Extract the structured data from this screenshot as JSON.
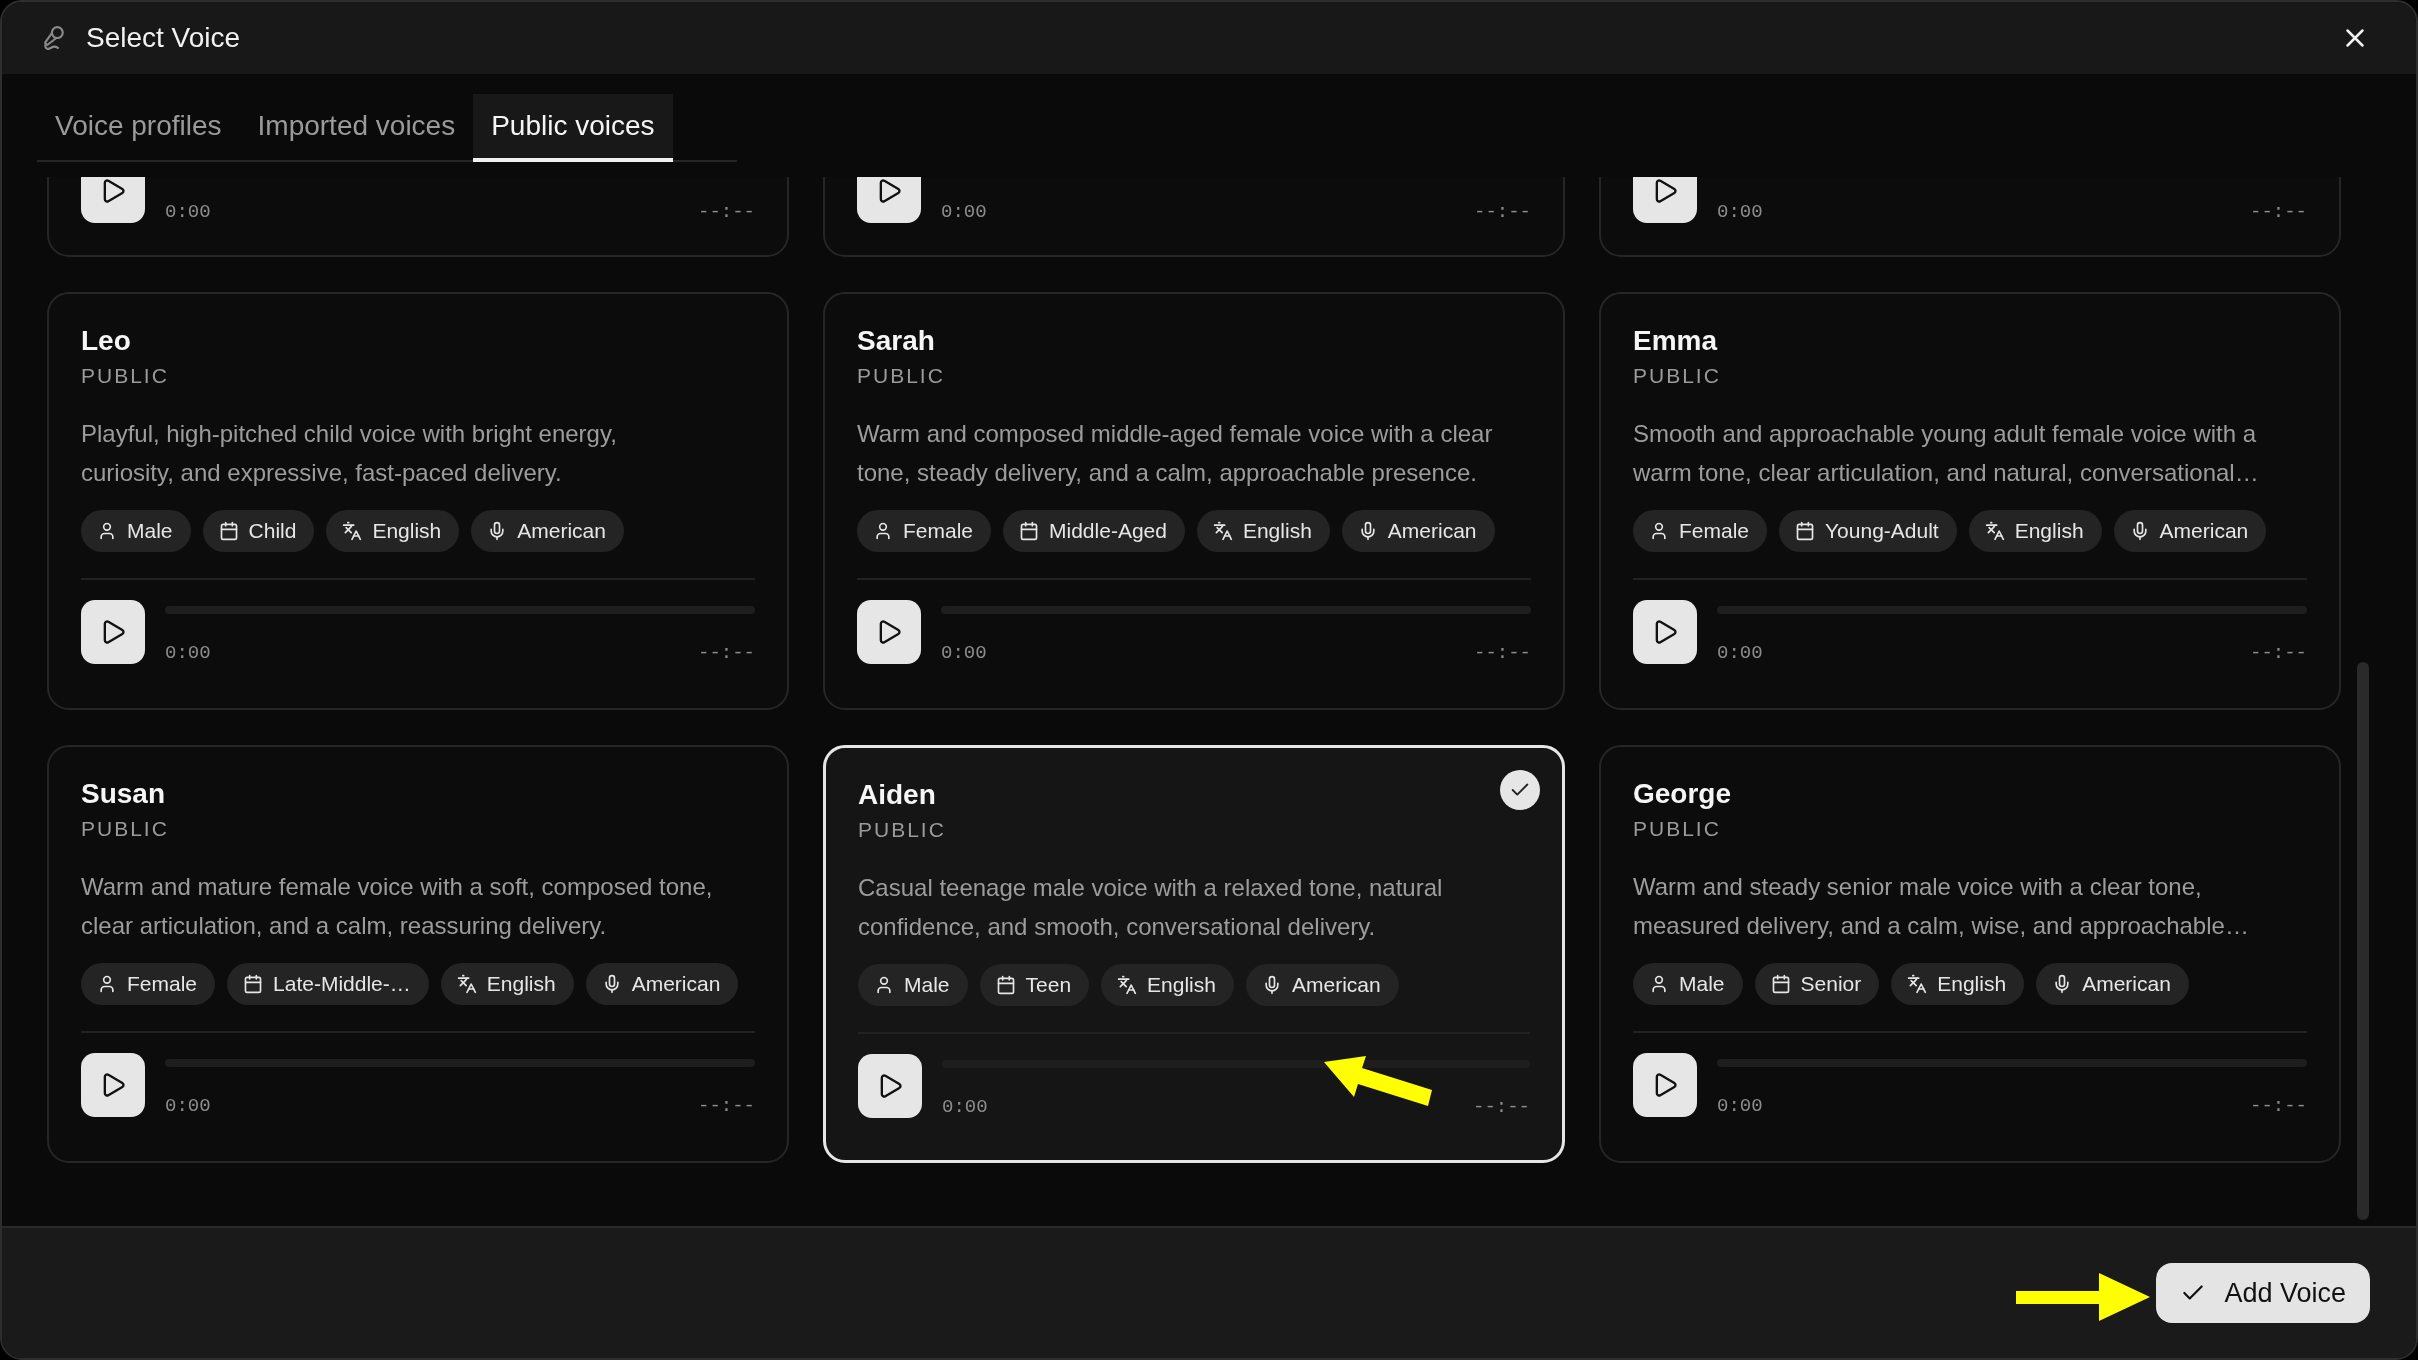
{
  "dialog": {
    "title": "Select Voice"
  },
  "tabs": [
    {
      "label": "Voice profiles",
      "selected": false
    },
    {
      "label": "Imported voices",
      "selected": false
    },
    {
      "label": "Public voices",
      "selected": true
    }
  ],
  "voices": [
    {
      "kind": "partial",
      "selected": false,
      "time": "0:00",
      "duration": "--:--"
    },
    {
      "kind": "partial",
      "selected": false,
      "time": "0:00",
      "duration": "--:--"
    },
    {
      "kind": "partial",
      "selected": false,
      "time": "0:00",
      "duration": "--:--"
    },
    {
      "kind": "full",
      "selected": false,
      "name": "Leo",
      "visibility": "PUBLIC",
      "description": "Playful, high-pitched child voice with bright energy,\ncuriosity, and expressive, fast-paced delivery.",
      "tags": [
        {
          "kind": "gender",
          "label": "Male"
        },
        {
          "kind": "age",
          "label": "Child"
        },
        {
          "kind": "language",
          "label": "English"
        },
        {
          "kind": "accent",
          "label": "American"
        }
      ],
      "time": "0:00",
      "duration": "--:--"
    },
    {
      "kind": "full",
      "selected": false,
      "name": "Sarah",
      "visibility": "PUBLIC",
      "description": "Warm and composed middle-aged female voice with a clear\ntone, steady delivery, and a calm, approachable presence.",
      "tags": [
        {
          "kind": "gender",
          "label": "Female"
        },
        {
          "kind": "age",
          "label": "Middle-Aged"
        },
        {
          "kind": "language",
          "label": "English"
        },
        {
          "kind": "accent",
          "label": "American"
        }
      ],
      "time": "0:00",
      "duration": "--:--"
    },
    {
      "kind": "full",
      "selected": false,
      "name": "Emma",
      "visibility": "PUBLIC",
      "description": "Smooth and approachable young adult female voice with a\nwarm tone, clear articulation, and natural, conversational…",
      "tags": [
        {
          "kind": "gender",
          "label": "Female"
        },
        {
          "kind": "age",
          "label": "Young-Adult"
        },
        {
          "kind": "language",
          "label": "English"
        },
        {
          "kind": "accent",
          "label": "American"
        }
      ],
      "time": "0:00",
      "duration": "--:--"
    },
    {
      "kind": "full",
      "selected": false,
      "name": "Susan",
      "visibility": "PUBLIC",
      "description": "Warm and mature female voice with a soft, composed tone,\nclear articulation, and a calm, reassuring delivery.",
      "tags": [
        {
          "kind": "gender",
          "label": "Female"
        },
        {
          "kind": "age",
          "label": "Late-Middle-…"
        },
        {
          "kind": "language",
          "label": "English"
        },
        {
          "kind": "accent",
          "label": "American"
        }
      ],
      "time": "0:00",
      "duration": "--:--"
    },
    {
      "kind": "full",
      "selected": true,
      "name": "Aiden",
      "visibility": "PUBLIC",
      "description": "Casual teenage male voice with a relaxed tone, natural\nconfidence, and smooth, conversational delivery.",
      "tags": [
        {
          "kind": "gender",
          "label": "Male"
        },
        {
          "kind": "age",
          "label": "Teen"
        },
        {
          "kind": "language",
          "label": "English"
        },
        {
          "kind": "accent",
          "label": "American"
        }
      ],
      "time": "0:00",
      "duration": "--:--"
    },
    {
      "kind": "full",
      "selected": false,
      "name": "George",
      "visibility": "PUBLIC",
      "description": "Warm and steady senior male voice with a clear tone,\nmeasured delivery, and a calm, wise, and approachable…",
      "tags": [
        {
          "kind": "gender",
          "label": "Male"
        },
        {
          "kind": "age",
          "label": "Senior"
        },
        {
          "kind": "language",
          "label": "English"
        },
        {
          "kind": "accent",
          "label": "American"
        }
      ],
      "time": "0:00",
      "duration": "--:--"
    }
  ],
  "footer": {
    "button": "Add Voice"
  }
}
